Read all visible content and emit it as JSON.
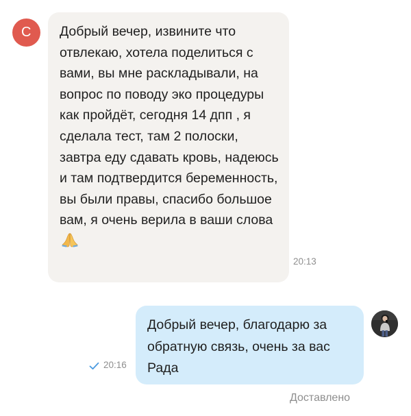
{
  "incoming": {
    "avatar_initial": "С",
    "avatar_color": "#e05a4f",
    "text": "Добрый вечер, извините что отвлекаю, хотела поделиться с вами, вы мне раскладывали, на вопрос по поводу эко процедуры как пройдёт, сегодня 14 дпп , я сделала тест, там 2 полоски, завтра еду сдавать кровь, надеюсь и там подтвердится беременность, вы были правы, спасибо большое вам, я очень верила в ваши слова",
    "emoji": "folded-hands",
    "time": "20:13"
  },
  "outgoing": {
    "text": "Добрый вечер, благодарю за обратную связь, очень за вас Рада",
    "time": "20:16",
    "read_icon": "check-icon",
    "status": "Доставлено"
  },
  "colors": {
    "incoming_bubble": "#f4f2ef",
    "outgoing_bubble": "#d4ecfb",
    "meta_text": "#8e8e8e",
    "check": "#4a9ae0"
  }
}
